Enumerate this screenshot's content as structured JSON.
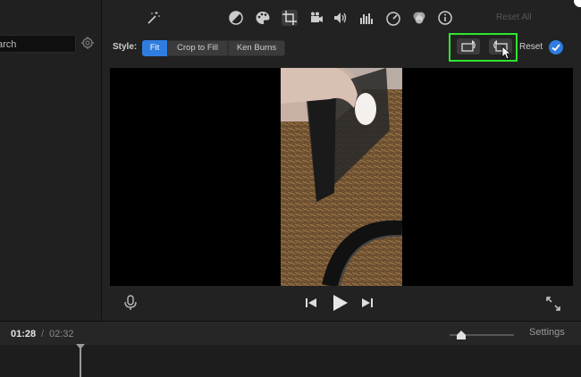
{
  "sidebar": {
    "search_value": "arch",
    "filter_icon": "gear-icon"
  },
  "toolbar": {
    "tools": [
      "magic-wand-icon",
      "color-balance-icon",
      "color-palette-icon",
      "crop-icon",
      "video-camera-icon",
      "volume-icon",
      "equalizer-icon",
      "speed-icon",
      "filter-icon",
      "info-icon"
    ],
    "active_tool": "crop-icon",
    "reset_all_label": "Reset All"
  },
  "crop": {
    "style_label": "Style:",
    "styles": [
      "Fit",
      "Crop to Fill",
      "Ken Burns"
    ],
    "selected_style": "Fit",
    "rotate_left_icon": "rotate-counterclockwise-icon",
    "rotate_right_icon": "rotate-clockwise-icon",
    "reset_label": "Reset",
    "apply_icon": "checkmark-icon",
    "highlight_color": "#2ee62e"
  },
  "playback": {
    "current_time": "01:28",
    "separator": "/",
    "total_time": "02:32",
    "settings_label": "Settings"
  },
  "colors": {
    "accent": "#2f7de1",
    "background": "#1b1b1b"
  }
}
